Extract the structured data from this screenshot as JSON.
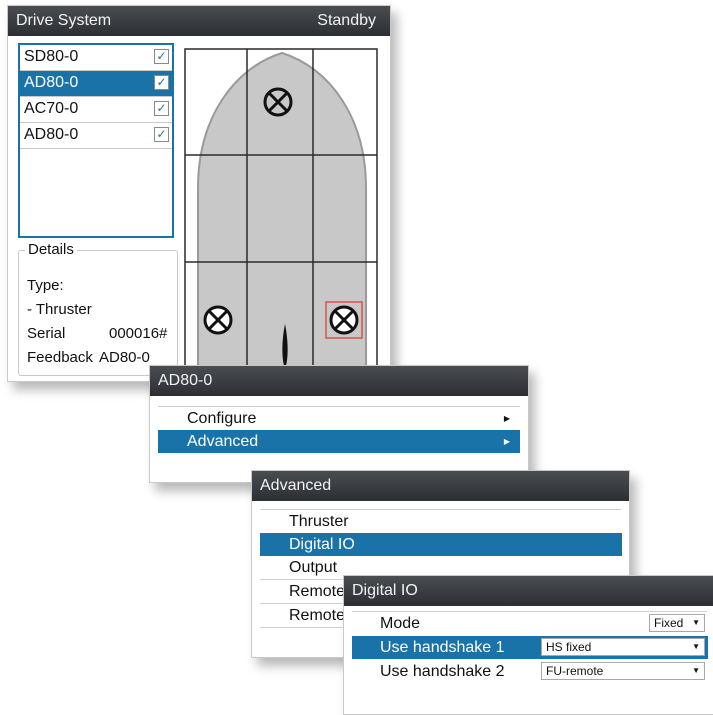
{
  "drive_window": {
    "title": "Drive System",
    "status": "Standby",
    "drives": [
      {
        "label": "SD80-0",
        "checked": true,
        "selected": false
      },
      {
        "label": "AD80-0",
        "checked": true,
        "selected": true
      },
      {
        "label": "AC70-0",
        "checked": true,
        "selected": false
      },
      {
        "label": "AD80-0",
        "checked": true,
        "selected": false
      }
    ],
    "details": {
      "legend": "Details",
      "type_label": "Type:",
      "type_value": "- Thruster",
      "serial_label": "Serial",
      "serial_value": "000016#",
      "feedback_label": "Feedback",
      "feedback_value": "AD80-0"
    }
  },
  "ad80_menu": {
    "title": "AD80-0",
    "items": [
      {
        "label": "Configure",
        "has_submenu": true,
        "selected": false
      },
      {
        "label": "Advanced",
        "has_submenu": true,
        "selected": true
      }
    ]
  },
  "advanced_menu": {
    "title": "Advanced",
    "items": [
      "Thruster",
      "Digital IO",
      "Output",
      "Remote",
      "Remote"
    ],
    "selected_index": 1
  },
  "digital_io": {
    "title": "Digital IO",
    "rows": [
      {
        "label": "Mode",
        "value": "Fixed",
        "selected": false
      },
      {
        "label": "Use handshake 1",
        "value": "HS fixed",
        "selected": true
      },
      {
        "label": "Use handshake 2",
        "value": "FU-remote",
        "selected": false
      }
    ]
  },
  "theme": {
    "accent": "#1a73a8",
    "titlebar": "#2c2e33",
    "hull_fill": "#c8c8c8"
  }
}
